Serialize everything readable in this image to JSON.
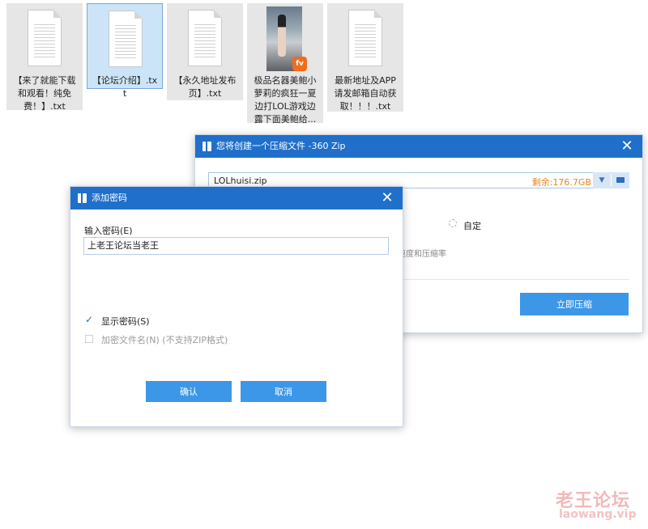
{
  "desktop": {
    "files": [
      {
        "label": "【来了就能下载和观看！纯免费！】.txt",
        "type": "txt",
        "selected": false
      },
      {
        "label": "【论坛介绍】.txt",
        "type": "txt",
        "selected": true
      },
      {
        "label": "【永久地址发布页】.txt",
        "type": "txt",
        "selected": false
      },
      {
        "label": "极品名器美鲍小萝莉的疯狂一夏边打LOL游戏边露下面美鲍给...",
        "type": "video",
        "selected": false,
        "badge": "fv"
      },
      {
        "label": "最新地址及APP请发邮箱自动获取！！！.txt",
        "type": "txt",
        "selected": false
      }
    ]
  },
  "zip_dialog": {
    "title": "您将创建一个压缩文件 -360 Zip",
    "close_glyph": "✕",
    "filename": "LOLhuisi.zip",
    "free_space": "剩余:176.7GB",
    "custom_label": "自定",
    "speed_text": "速度和压缩率",
    "compress_button": "立即压缩"
  },
  "password_dialog": {
    "title": "添加密码",
    "close_glyph": "✕",
    "input_label": "输入密码(E)",
    "password_value": "上老王论坛当老王",
    "show_password": {
      "label": "显示密码(S)",
      "checked": true
    },
    "encrypt_filenames": {
      "label": "加密文件名(N) (不支持ZIP格式)",
      "checked": false,
      "enabled": false
    },
    "ok_button": "确认",
    "cancel_button": "取消"
  },
  "watermark": {
    "title": "老王论坛",
    "url": "laowang.vip"
  },
  "colors": {
    "titlebar": "#1f6fcb",
    "primary_button": "#3d97e8",
    "free_space": "#e8841b"
  }
}
